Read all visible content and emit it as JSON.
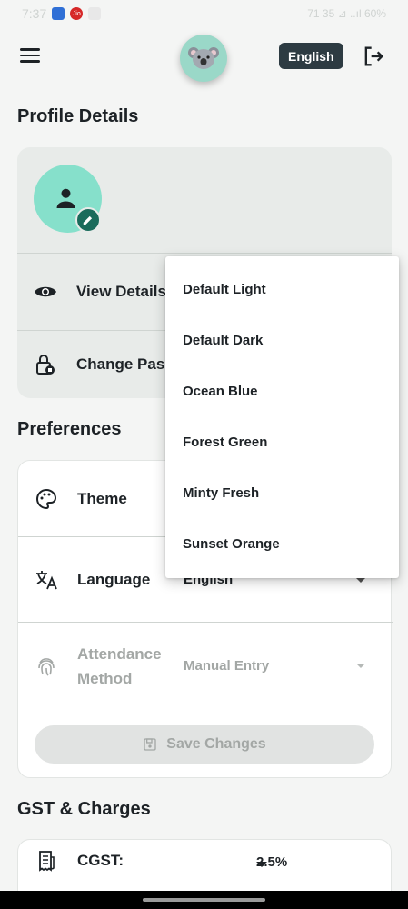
{
  "status_bar": {
    "time": "7:37",
    "carrier_badge": "Jio",
    "right_text": "71 35 ⊿ ..ıl 60%"
  },
  "header": {
    "language_button": "English"
  },
  "profile": {
    "section_title": "Profile Details",
    "view_details_label": "View Details",
    "change_password_label": "Change Pas"
  },
  "preferences": {
    "section_title": "Preferences",
    "theme_label": "Theme",
    "language_label": "Language",
    "language_value": "English",
    "attendance_label_line1": "Attendance",
    "attendance_label_line2": "Method",
    "attendance_value": "Manual Entry",
    "save_label": "Save Changes"
  },
  "theme_menu": {
    "options": [
      "Default Light",
      "Default Dark",
      "Ocean Blue",
      "Forest Green",
      "Minty Fresh",
      "Sunset Orange"
    ]
  },
  "gst": {
    "section_title": "GST & Charges",
    "cgst_label": "CGST:",
    "cgst_value": "2.5%"
  },
  "icons": [
    "menu-icon",
    "koala-avatar",
    "logout-icon",
    "person-icon",
    "pencil-icon",
    "eye-icon",
    "lock-icon",
    "palette-icon",
    "translate-icon",
    "fingerprint-icon",
    "save-icon",
    "receipt-icon",
    "caret-down-icon"
  ],
  "colors": {
    "accent": "#86e0cb",
    "dark_accent": "#1a6b5b",
    "lang_button_bg": "#2d3b42"
  }
}
